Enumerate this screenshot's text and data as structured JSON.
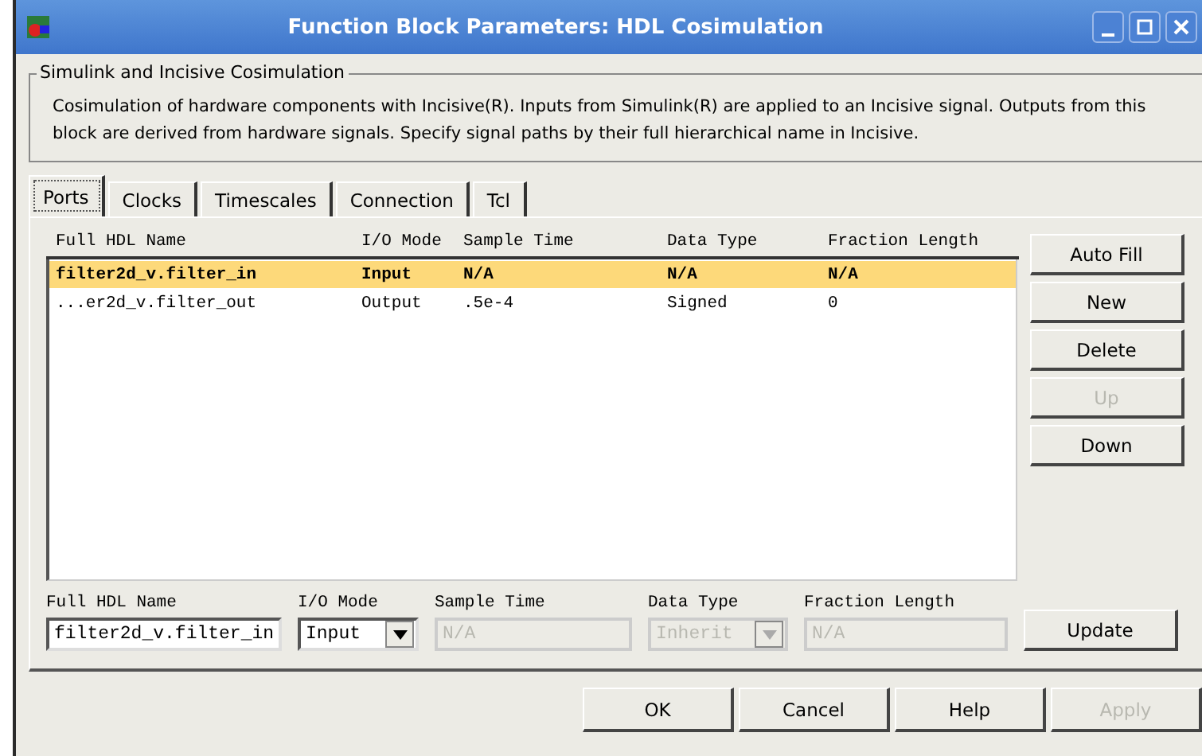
{
  "window": {
    "title": "Function Block Parameters: HDL Cosimulation"
  },
  "group": {
    "title": "Simulink and Incisive Cosimulation",
    "description": "Cosimulation of hardware components with Incisive(R). Inputs from Simulink(R) are applied to an Incisive signal. Outputs from this block are derived from hardware signals. Specify signal paths by their full hierarchical name in Incisive."
  },
  "tabs": [
    {
      "label": "Ports",
      "selected": true
    },
    {
      "label": "Clocks",
      "selected": false
    },
    {
      "label": "Timescales",
      "selected": false
    },
    {
      "label": "Connection",
      "selected": false
    },
    {
      "label": "Tcl",
      "selected": false
    }
  ],
  "table": {
    "columns": [
      "Full HDL Name",
      "I/O Mode",
      "Sample Time",
      "Data Type",
      "Fraction Length"
    ],
    "rows": [
      {
        "selected": true,
        "cells": [
          "filter2d_v.filter_in",
          "Input",
          "N/A",
          "N/A",
          "N/A"
        ]
      },
      {
        "selected": false,
        "cells": [
          "...er2d_v.filter_out",
          "Output",
          ".5e-4",
          "Signed",
          "0"
        ]
      }
    ]
  },
  "side_buttons": [
    {
      "label": "Auto Fill",
      "disabled": false
    },
    {
      "label": "New",
      "disabled": false
    },
    {
      "label": "Delete",
      "disabled": false
    },
    {
      "label": "Up",
      "disabled": true
    },
    {
      "label": "Down",
      "disabled": false
    }
  ],
  "editor": [
    {
      "kind": "text",
      "label": "Full HDL Name",
      "value": "filter2d_v.filter_in",
      "disabled": false
    },
    {
      "kind": "select",
      "label": "I/O Mode",
      "value": "Input",
      "disabled": false
    },
    {
      "kind": "text",
      "label": "Sample Time",
      "value": "N/A",
      "disabled": true
    },
    {
      "kind": "select",
      "label": "Data Type",
      "value": "Inherit",
      "disabled": true
    },
    {
      "kind": "text",
      "label": "Fraction Length",
      "value": "N/A",
      "disabled": true
    }
  ],
  "update_button": {
    "label": "Update"
  },
  "dialog_buttons": [
    {
      "label": "OK",
      "disabled": false
    },
    {
      "label": "Cancel",
      "disabled": false
    },
    {
      "label": "Help",
      "disabled": false
    },
    {
      "label": "Apply",
      "disabled": true
    }
  ]
}
